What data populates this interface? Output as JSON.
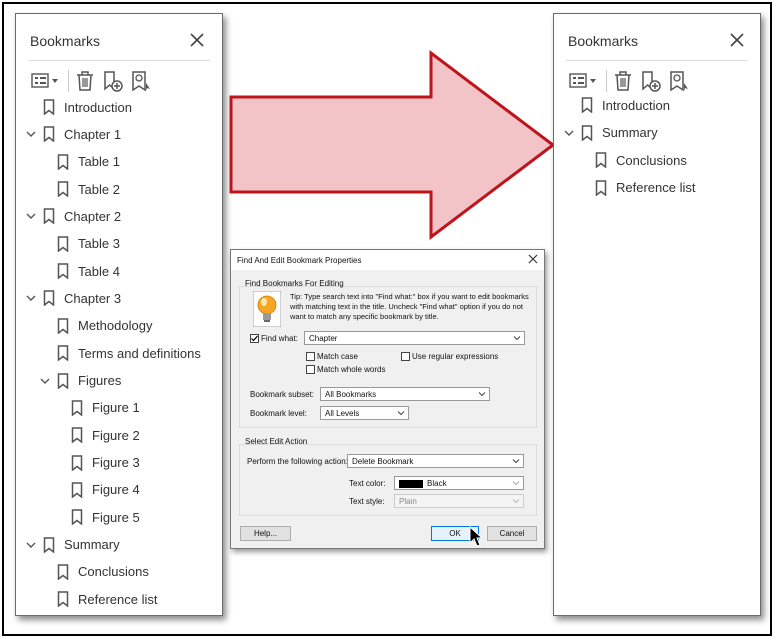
{
  "left_panel": {
    "title": "Bookmarks",
    "items": [
      {
        "label": "Introduction"
      },
      {
        "label": "Chapter 1"
      },
      {
        "label": "Table 1"
      },
      {
        "label": "Table 2"
      },
      {
        "label": "Chapter 2"
      },
      {
        "label": "Table 3"
      },
      {
        "label": "Table 4"
      },
      {
        "label": "Chapter 3"
      },
      {
        "label": "Methodology"
      },
      {
        "label": "Terms and definitions"
      },
      {
        "label": "Figures"
      },
      {
        "label": "Figure 1"
      },
      {
        "label": "Figure 2"
      },
      {
        "label": "Figure 3"
      },
      {
        "label": "Figure 4"
      },
      {
        "label": "Figure 5"
      },
      {
        "label": "Summary"
      },
      {
        "label": "Conclusions"
      },
      {
        "label": "Reference list"
      }
    ]
  },
  "right_panel": {
    "title": "Bookmarks",
    "items": [
      {
        "label": "Introduction"
      },
      {
        "label": "Summary"
      },
      {
        "label": "Conclusions"
      },
      {
        "label": "Reference list"
      }
    ]
  },
  "icons": {
    "options": "options-menu-icon",
    "delete": "trash-icon",
    "new": "new-bookmark-icon",
    "from_structure": "bookmark-from-structure-icon",
    "bookmark": "bookmark-icon",
    "expanded": "chevron-down-icon",
    "close": "close-icon",
    "tip": "lightbulb-icon",
    "cursor": "mouse-pointer-icon"
  },
  "colors": {
    "arrow_fill": "#f2c4c7",
    "arrow_stroke": "#c0141c",
    "bulb": "#f5a623"
  },
  "dialog": {
    "title": "Find And Edit Bookmark Properties",
    "find_group_label": "Find Bookmarks For Editing",
    "tip_text": "Tip: Type search text into \"Find what:\" box if you want to edit bookmarks with matching text in the title. Uncheck \"Find what\" option if you do not want to match any specific bookmark by title.",
    "find_what_label": "Find what:",
    "find_what_value": "Chapter",
    "match_case_label": "Match case",
    "use_regex_label": "Use regular expressions",
    "match_whole_label": "Match whole words",
    "subset_label": "Bookmark subset:",
    "subset_value": "All Bookmarks",
    "level_label": "Bookmark level:",
    "level_value": "All Levels",
    "edit_group_label": "Select Edit Action",
    "action_label": "Perform the following action:",
    "action_value": "Delete Bookmark",
    "text_color_label": "Text color:",
    "text_color_value": "Black",
    "text_style_label": "Text style:",
    "text_style_value": "Plain",
    "help_button": "Help...",
    "ok_button": "OK",
    "cancel_button": "Cancel"
  }
}
